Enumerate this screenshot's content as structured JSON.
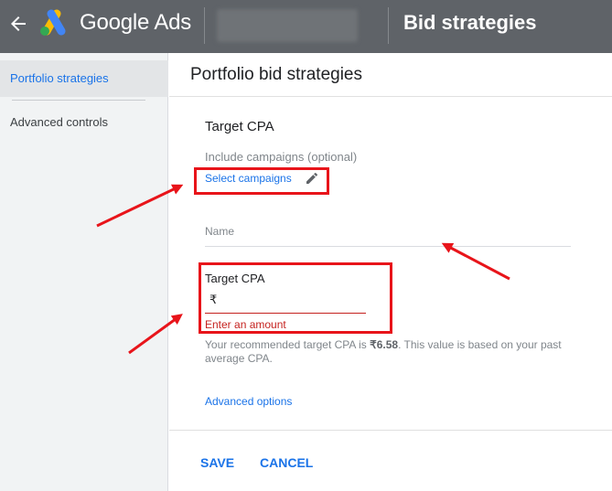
{
  "topbar": {
    "brand": "Google Ads",
    "page_heading": "Bid strategies",
    "back_icon": "arrow-back-icon",
    "logo_icon": "google-ads-logo",
    "account": "",
    "background_color": "#5f6368"
  },
  "sidebar": {
    "items": [
      {
        "label": "Portfolio strategies",
        "active": true
      },
      {
        "label": "Advanced controls",
        "active": false
      }
    ]
  },
  "main": {
    "title": "Portfolio bid strategies",
    "strategy_type": "Target CPA",
    "include_label": "Include campaigns (optional)",
    "select_campaigns": "Select campaigns",
    "edit_icon": "pencil-icon",
    "name_placeholder": "Name",
    "target_cpa": {
      "label": "Target CPA",
      "currency": "₹",
      "value": "",
      "error": "Enter an amount"
    },
    "recommendation": {
      "prefix": "Your recommended target CPA is ",
      "amount": "₹6.58",
      "suffix": ". This value is based on your past average CPA."
    },
    "advanced_options": "Advanced options",
    "save": "SAVE",
    "cancel": "CANCEL"
  },
  "colors": {
    "accent": "#1a73e8",
    "error": "#c5221f",
    "annotation": "#e8141a"
  }
}
